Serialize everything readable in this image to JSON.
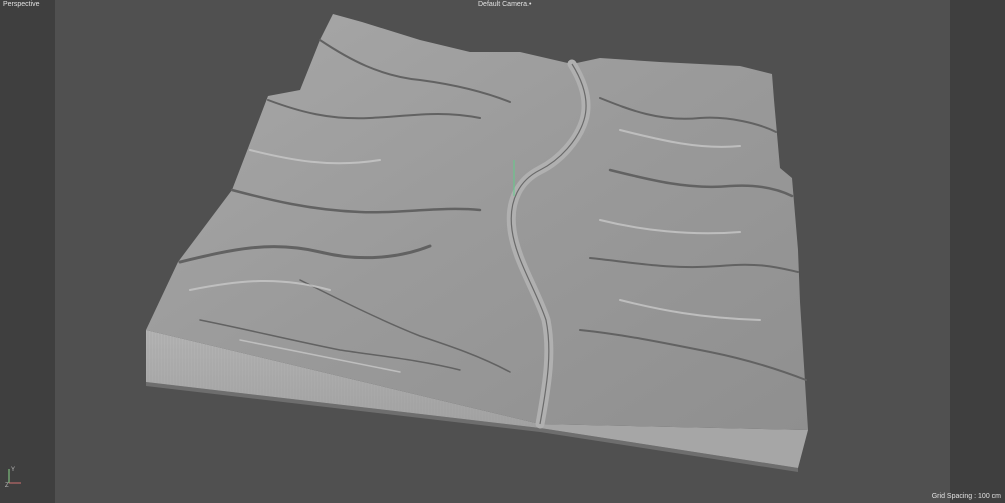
{
  "viewport": {
    "view_name": "Perspective",
    "camera_name": "Default Camera",
    "camera_suffix": ".•",
    "grid_spacing": "Grid Spacing : 100 cm"
  },
  "axis": {
    "y_label": "Y",
    "z_label": "Z"
  },
  "colors": {
    "viewport_bg": "#505050",
    "side_bg": "#3f3f3f",
    "terrain_top": "#9c9c9c",
    "terrain_side": "#b7b7b7",
    "terrain_shadow": "#5c5c5c"
  }
}
